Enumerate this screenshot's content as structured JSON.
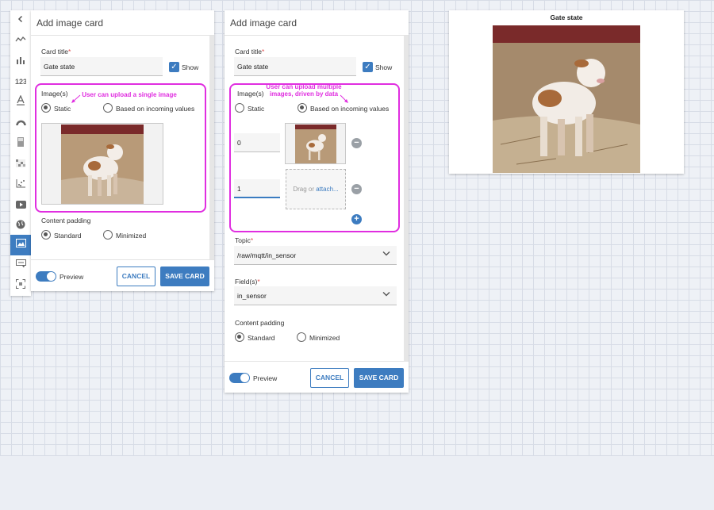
{
  "left_panel": {
    "title": "Add image card",
    "card_title_label": "Card title",
    "required_mark": "*",
    "card_title_value": "Gate state",
    "show_label": "Show",
    "images_label": "Image(s)",
    "radio_static": "Static",
    "radio_incoming": "Based on incoming values",
    "annotation": "User can upload a single image",
    "content_padding_label": "Content padding",
    "padding_standard": "Standard",
    "padding_minimized": "Minimized",
    "preview_label": "Preview",
    "cancel_label": "CANCEL",
    "save_label": "SAVE CARD"
  },
  "middle_panel": {
    "title": "Add image card",
    "card_title_label": "Card title",
    "required_mark": "*",
    "card_title_value": "Gate state",
    "show_label": "Show",
    "images_label": "Image(s)",
    "radio_static": "Static",
    "radio_incoming": "Based on incoming values",
    "annotation": "User can upload multiple images, driven by data",
    "value_1": "0",
    "value_2": "1",
    "drop_text": "Drag or ",
    "drop_link": "attach...",
    "topic_label": "Topic",
    "topic_value": "/raw/mqtt/in_sensor",
    "fields_label": "Field(s)",
    "fields_value": "in_sensor",
    "content_padding_label": "Content padding",
    "padding_standard": "Standard",
    "padding_minimized": "Minimized",
    "preview_label": "Preview",
    "cancel_label": "CANCEL",
    "save_label": "SAVE CARD"
  },
  "preview_card": {
    "title": "Gate state"
  },
  "icons": {
    "back": "chevron-left-icon",
    "sparkline": "sparkline-icon",
    "bar": "bar-chart-icon",
    "number": "number-icon",
    "text": "text-icon",
    "gauge": "gauge-icon",
    "tank": "tank-icon",
    "heatmap": "heatmap-icon",
    "scatter": "scatter-icon",
    "video": "video-icon",
    "globe": "globe-icon",
    "image": "image-icon",
    "command": "command-icon",
    "scan": "scan-icon"
  },
  "colors": {
    "accent": "#3d7cc0",
    "annotation": "#e02ee0"
  }
}
